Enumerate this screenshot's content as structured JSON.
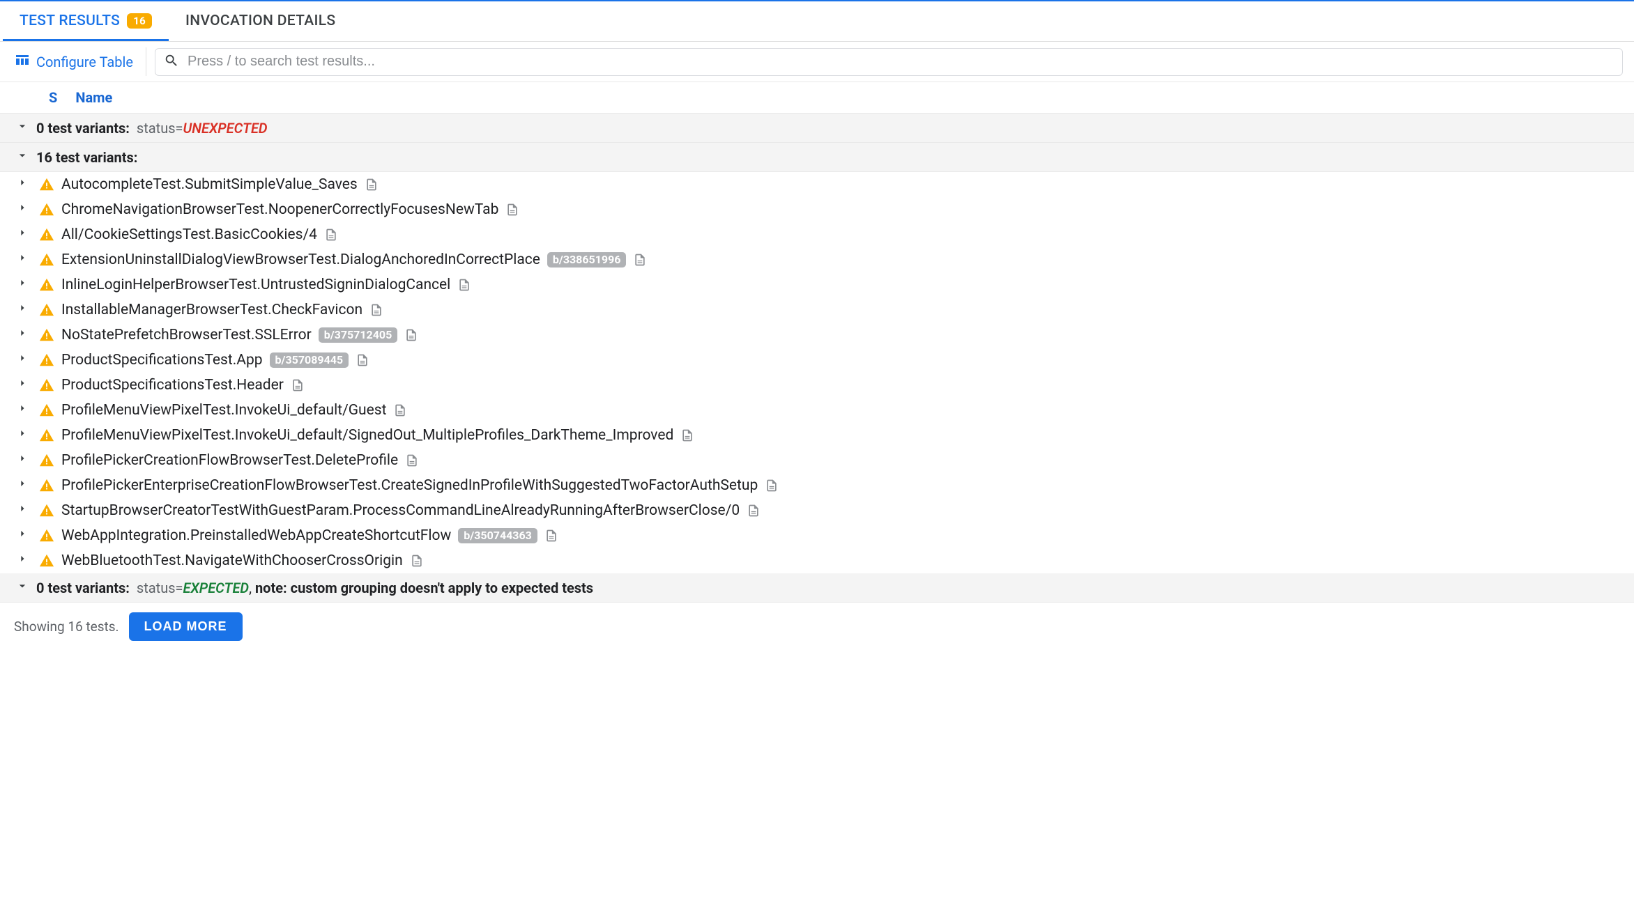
{
  "tabs": {
    "test_results": "TEST RESULTS",
    "test_results_count": "16",
    "invocation_details": "INVOCATION DETAILS"
  },
  "toolbar": {
    "configure_label": "Configure Table",
    "search_placeholder": "Press / to search test results..."
  },
  "columns": {
    "status": "S",
    "name": "Name"
  },
  "groups": {
    "unexpected": {
      "count_label": "0 test variants:",
      "status_prefix": "status=",
      "status_value": "UNEXPECTED"
    },
    "main": {
      "count_label": "16 test variants:"
    },
    "expected": {
      "count_label": "0 test variants:",
      "status_prefix": "status=",
      "status_value": "EXPECTED",
      "note_sep": ", ",
      "note": "note: custom grouping doesn't apply to expected tests"
    }
  },
  "tests": [
    {
      "name": "AutocompleteTest.SubmitSimpleValue_Saves",
      "bug": null
    },
    {
      "name": "ChromeNavigationBrowserTest.NoopenerCorrectlyFocusesNewTab",
      "bug": null
    },
    {
      "name": "All/CookieSettingsTest.BasicCookies/4",
      "bug": null
    },
    {
      "name": "ExtensionUninstallDialogViewBrowserTest.DialogAnchoredInCorrectPlace",
      "bug": "b/338651996"
    },
    {
      "name": "InlineLoginHelperBrowserTest.UntrustedSigninDialogCancel",
      "bug": null
    },
    {
      "name": "InstallableManagerBrowserTest.CheckFavicon",
      "bug": null
    },
    {
      "name": "NoStatePrefetchBrowserTest.SSLError",
      "bug": "b/375712405"
    },
    {
      "name": "ProductSpecificationsTest.App",
      "bug": "b/357089445"
    },
    {
      "name": "ProductSpecificationsTest.Header",
      "bug": null
    },
    {
      "name": "ProfileMenuViewPixelTest.InvokeUi_default/Guest",
      "bug": null
    },
    {
      "name": "ProfileMenuViewPixelTest.InvokeUi_default/SignedOut_MultipleProfiles_DarkTheme_Improved",
      "bug": null
    },
    {
      "name": "ProfilePickerCreationFlowBrowserTest.DeleteProfile",
      "bug": null
    },
    {
      "name": "ProfilePickerEnterpriseCreationFlowBrowserTest.CreateSignedInProfileWithSuggestedTwoFactorAuthSetup",
      "bug": null
    },
    {
      "name": "StartupBrowserCreatorTestWithGuestParam.ProcessCommandLineAlreadyRunningAfterBrowserClose/0",
      "bug": null
    },
    {
      "name": "WebAppIntegration.PreinstalledWebAppCreateShortcutFlow",
      "bug": "b/350744363"
    },
    {
      "name": "WebBluetoothTest.NavigateWithChooserCrossOrigin",
      "bug": null
    }
  ],
  "footer": {
    "showing": "Showing 16 tests.",
    "load_more": "LOAD MORE"
  }
}
